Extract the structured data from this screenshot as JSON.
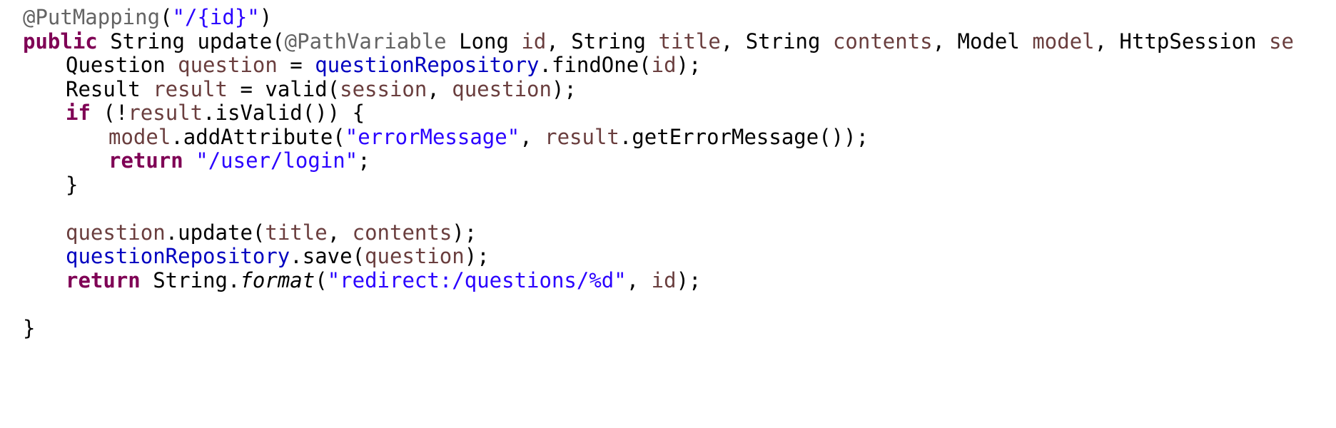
{
  "editor": {
    "background": "#ffffff",
    "colors": {
      "annotation": "#646464",
      "keyword": "#7f0055",
      "string": "#2a00ff",
      "field": "#0000c0",
      "local_variable": "#6a3e3e",
      "plain": "#000000"
    },
    "lines": [
      {
        "indent": 1,
        "tokens": [
          {
            "type": "annotation",
            "text": "@PutMapping"
          },
          {
            "type": "plain",
            "text": "("
          },
          {
            "type": "string",
            "text": "\"/{id}\""
          },
          {
            "type": "plain",
            "text": ")"
          }
        ]
      },
      {
        "indent": 1,
        "tokens": [
          {
            "type": "keyword",
            "text": "public"
          },
          {
            "type": "plain",
            "text": " String update("
          },
          {
            "type": "annotation",
            "text": "@PathVariable"
          },
          {
            "type": "plain",
            "text": " Long "
          },
          {
            "type": "local",
            "text": "id"
          },
          {
            "type": "plain",
            "text": ", String "
          },
          {
            "type": "local",
            "text": "title"
          },
          {
            "type": "plain",
            "text": ", String "
          },
          {
            "type": "local",
            "text": "contents"
          },
          {
            "type": "plain",
            "text": ", Model "
          },
          {
            "type": "local",
            "text": "model"
          },
          {
            "type": "plain",
            "text": ", HttpSession "
          },
          {
            "type": "local",
            "text": "se"
          }
        ]
      },
      {
        "indent": 2,
        "tokens": [
          {
            "type": "plain",
            "text": "Question "
          },
          {
            "type": "local",
            "text": "question"
          },
          {
            "type": "plain",
            "text": " = "
          },
          {
            "type": "field",
            "text": "questionRepository"
          },
          {
            "type": "plain",
            "text": ".findOne("
          },
          {
            "type": "local",
            "text": "id"
          },
          {
            "type": "plain",
            "text": ");"
          }
        ]
      },
      {
        "indent": 2,
        "tokens": [
          {
            "type": "plain",
            "text": "Result "
          },
          {
            "type": "local",
            "text": "result"
          },
          {
            "type": "plain",
            "text": " = valid("
          },
          {
            "type": "local",
            "text": "session"
          },
          {
            "type": "plain",
            "text": ", "
          },
          {
            "type": "local",
            "text": "question"
          },
          {
            "type": "plain",
            "text": ");"
          }
        ]
      },
      {
        "indent": 2,
        "tokens": [
          {
            "type": "keyword",
            "text": "if"
          },
          {
            "type": "plain",
            "text": " (!"
          },
          {
            "type": "local",
            "text": "result"
          },
          {
            "type": "plain",
            "text": ".isValid()) {"
          }
        ]
      },
      {
        "indent": 3,
        "tokens": [
          {
            "type": "local",
            "text": "model"
          },
          {
            "type": "plain",
            "text": ".addAttribute("
          },
          {
            "type": "string",
            "text": "\"errorMessage\""
          },
          {
            "type": "plain",
            "text": ", "
          },
          {
            "type": "local",
            "text": "result"
          },
          {
            "type": "plain",
            "text": ".getErrorMessage());"
          }
        ]
      },
      {
        "indent": 3,
        "tokens": [
          {
            "type": "keyword",
            "text": "return"
          },
          {
            "type": "plain",
            "text": " "
          },
          {
            "type": "string",
            "text": "\"/user/login\""
          },
          {
            "type": "plain",
            "text": ";"
          }
        ]
      },
      {
        "indent": 2,
        "tokens": [
          {
            "type": "plain",
            "text": "}"
          }
        ]
      },
      {
        "indent": 0,
        "tokens": []
      },
      {
        "indent": 2,
        "tokens": [
          {
            "type": "local",
            "text": "question"
          },
          {
            "type": "plain",
            "text": ".update("
          },
          {
            "type": "local",
            "text": "title"
          },
          {
            "type": "plain",
            "text": ", "
          },
          {
            "type": "local",
            "text": "contents"
          },
          {
            "type": "plain",
            "text": ");"
          }
        ]
      },
      {
        "indent": 2,
        "tokens": [
          {
            "type": "field",
            "text": "questionRepository"
          },
          {
            "type": "plain",
            "text": ".save("
          },
          {
            "type": "local",
            "text": "question"
          },
          {
            "type": "plain",
            "text": ");"
          }
        ]
      },
      {
        "indent": 2,
        "tokens": [
          {
            "type": "keyword",
            "text": "return"
          },
          {
            "type": "plain",
            "text": " String."
          },
          {
            "type": "static",
            "text": "format"
          },
          {
            "type": "plain",
            "text": "("
          },
          {
            "type": "string",
            "text": "\"redirect:/questions/%d\""
          },
          {
            "type": "plain",
            "text": ", "
          },
          {
            "type": "local",
            "text": "id"
          },
          {
            "type": "plain",
            "text": ");"
          }
        ]
      },
      {
        "indent": 0,
        "tokens": []
      },
      {
        "indent": 1,
        "tokens": [
          {
            "type": "plain",
            "text": "}"
          }
        ]
      }
    ]
  }
}
